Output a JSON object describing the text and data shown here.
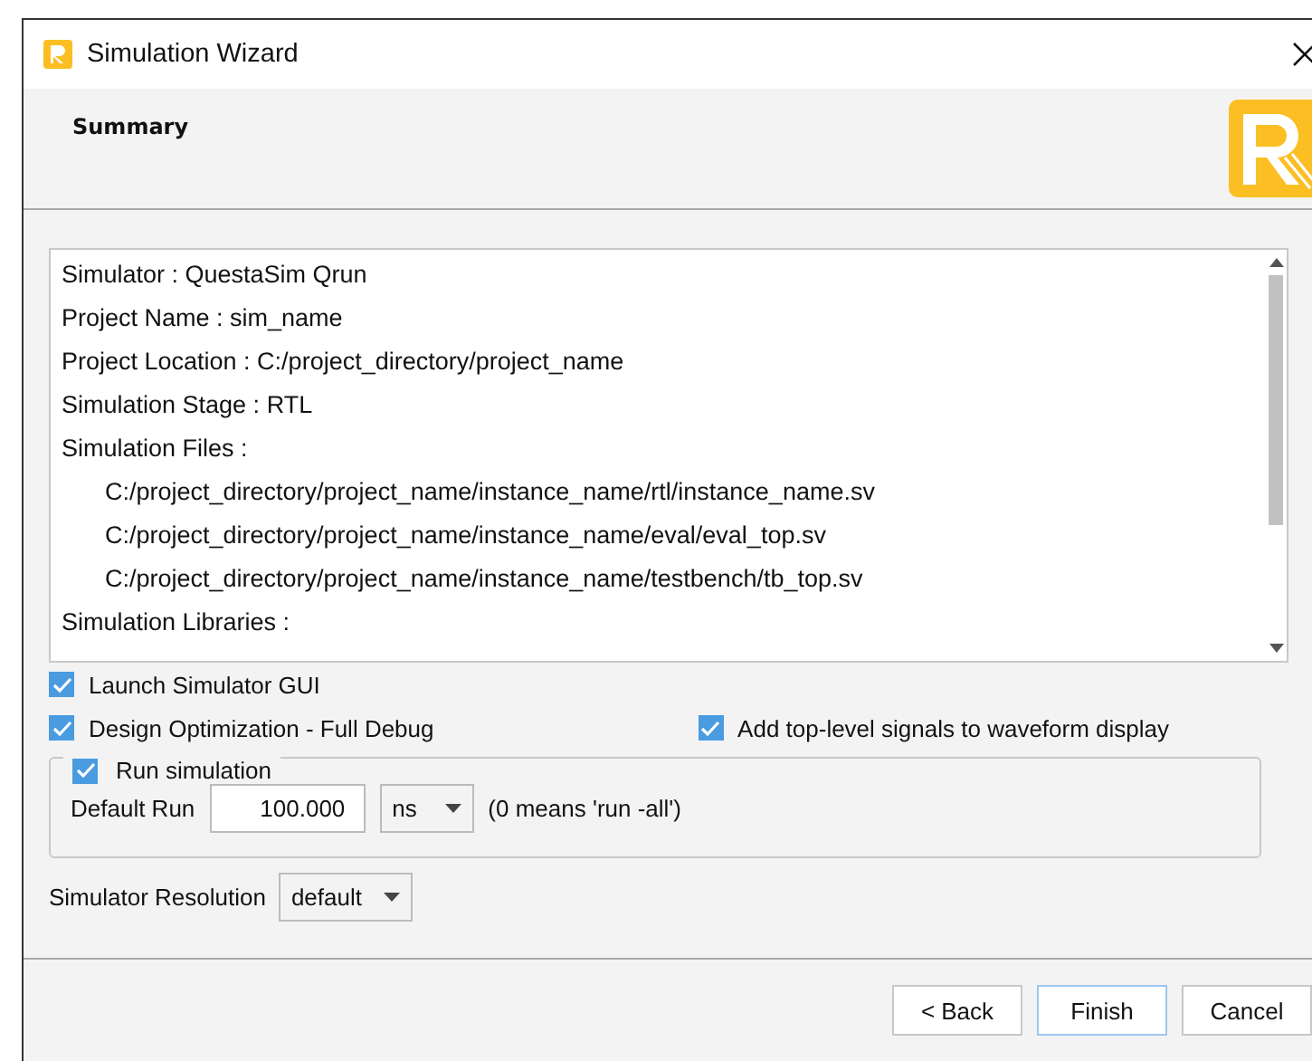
{
  "window": {
    "title": "Simulation Wizard"
  },
  "header": {
    "title": "Summary"
  },
  "summary": [
    {
      "text": "Simulator : QuestaSim Qrun",
      "indented": false
    },
    {
      "text": "Project Name : sim_name",
      "indented": false
    },
    {
      "text": "Project Location : C:/project_directory/project_name",
      "indented": false
    },
    {
      "text": "Simulation Stage : RTL",
      "indented": false
    },
    {
      "text": "Simulation Files :",
      "indented": false
    },
    {
      "text": "C:/project_directory/project_name/instance_name/rtl/instance_name.sv",
      "indented": true
    },
    {
      "text": "C:/project_directory/project_name/instance_name/eval/eval_top.sv",
      "indented": true
    },
    {
      "text": "C:/project_directory/project_name/instance_name/testbench/tb_top.sv",
      "indented": true
    },
    {
      "text": "Simulation Libraries :",
      "indented": false
    }
  ],
  "options": [
    {
      "label": "Launch Simulator GUI",
      "checked": true
    },
    {
      "label": "Design Optimization - Full Debug",
      "checked": true
    },
    {
      "label": "Add top-level signals to waveform display",
      "checked": true
    }
  ],
  "run_simulation": {
    "label": "Run simulation",
    "checked": true,
    "default_run_label": "Default Run",
    "default_run_value": "100.000",
    "unit": "ns",
    "hint": "(0 means 'run -all')"
  },
  "resolution": {
    "label": "Simulator Resolution",
    "value": "default"
  },
  "buttons": [
    {
      "label": "< Back",
      "focused": false
    },
    {
      "label": "Finish",
      "focused": true
    },
    {
      "label": "Cancel",
      "focused": false
    }
  ]
}
